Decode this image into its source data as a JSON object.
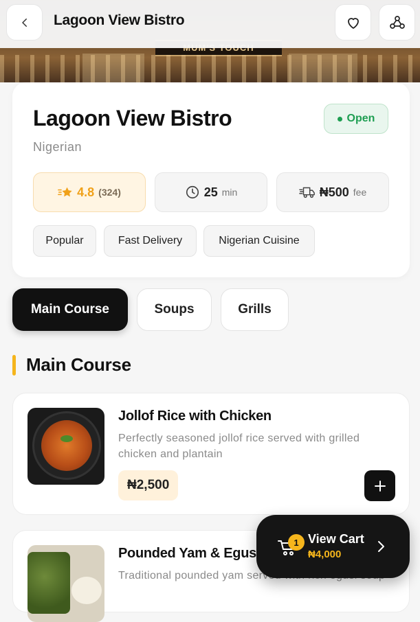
{
  "header": {
    "title": "Lagoon View Bistro",
    "banner_sign": "MUM'S TOUCH"
  },
  "restaurant": {
    "name": "Lagoon View Bistro",
    "cuisine": "Nigerian",
    "status": "Open",
    "rating": "4.8",
    "rating_count": "(324)",
    "delivery_time": "25",
    "delivery_time_unit": "min",
    "delivery_fee": "₦500",
    "delivery_fee_unit": "fee",
    "tags": [
      "Popular",
      "Fast Delivery",
      "Nigerian Cuisine"
    ]
  },
  "categories": {
    "tabs": [
      "Main Course",
      "Soups",
      "Grills"
    ],
    "active": "Main Course"
  },
  "section": {
    "title": "Main Course"
  },
  "menu": {
    "items": [
      {
        "name": "Jollof Rice with Chicken",
        "description": "Perfectly seasoned jollof rice served with grilled chicken and plantain",
        "price": "₦2,500"
      },
      {
        "name": "Pounded Yam & Egusi",
        "description": "Traditional pounded yam served with rich egusi soup"
      }
    ]
  },
  "cart": {
    "count": "1",
    "label": "View Cart",
    "total": "₦4,000"
  },
  "colors": {
    "accent": "#f5b51c",
    "open_green": "#1e9e52",
    "dark": "#111111"
  },
  "icons": {
    "back": "chevron-left-icon",
    "favorite": "heart-icon",
    "share": "share-icon",
    "rating": "star-icon",
    "time": "clock-icon",
    "delivery": "delivery-truck-icon",
    "add": "plus-icon",
    "cart": "cart-icon",
    "forward": "chevron-right-icon"
  }
}
